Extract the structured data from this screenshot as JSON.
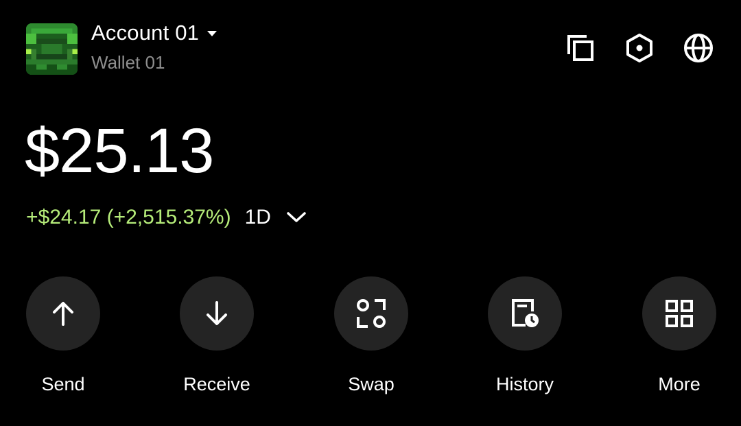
{
  "header": {
    "account_name": "Account 01",
    "wallet_name": "Wallet 01",
    "icons": [
      "copy-icon",
      "settings-hexagon-icon",
      "globe-icon"
    ]
  },
  "balance": {
    "amount": "$25.13",
    "change": "+$24.17 (+2,515.37%)",
    "period": "1D"
  },
  "actions": [
    {
      "label": "Send",
      "icon": "arrow-up-icon"
    },
    {
      "label": "Receive",
      "icon": "arrow-down-icon"
    },
    {
      "label": "Swap",
      "icon": "swap-icon"
    },
    {
      "label": "History",
      "icon": "history-icon"
    },
    {
      "label": "More",
      "icon": "grid-icon"
    }
  ],
  "colors": {
    "background": "#000000",
    "positive": "#b6ed7a",
    "muted_text": "#8e8e8e",
    "button_bg": "#242424"
  }
}
